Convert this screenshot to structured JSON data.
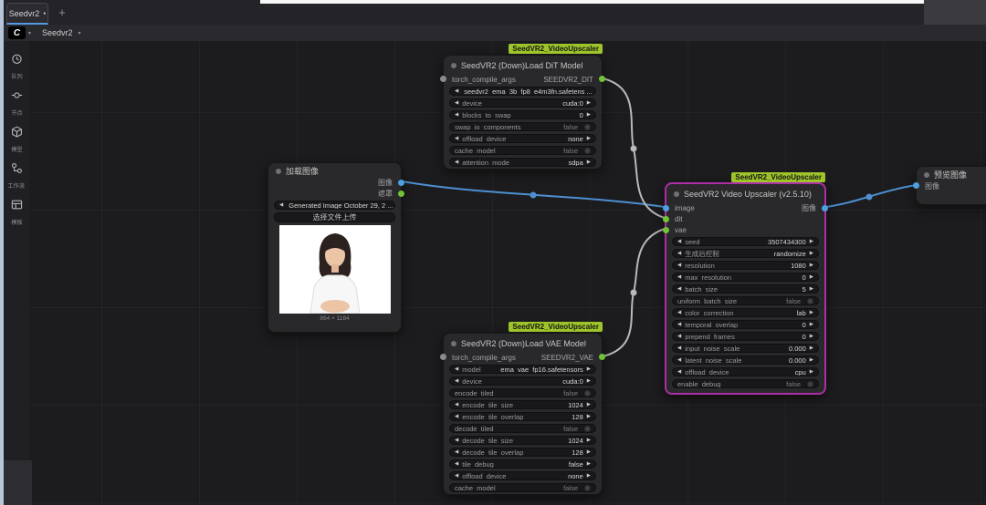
{
  "colors": {
    "link_image": "#4d8fd1",
    "link_model": "#b9b9b9",
    "slot_image_blue": "#4d9fe0",
    "slot_model_green": "#72c235",
    "group_tag_bg": "#9dc42a",
    "selected_node_border": "#ad2ea6",
    "tab_indicator": "#549ae0"
  },
  "icons": {
    "arrow_left": "◀",
    "arrow_right": "▶",
    "dirty_dot": "●",
    "caret_down": "▾",
    "plus": "+",
    "logo_letter": "C"
  },
  "tab_bar": {
    "active_tab": "Seedvr2"
  },
  "menu_bar": {
    "workflow_name": "Seedvr2"
  },
  "sidebar": {
    "items": [
      {
        "icon": "queue-icon",
        "label": "队列"
      },
      {
        "icon": "nodes-icon",
        "label": "节点"
      },
      {
        "icon": "models-icon",
        "label": "模型"
      },
      {
        "icon": "workflows-icon",
        "label": "工作流"
      },
      {
        "icon": "templates-icon",
        "label": "模板"
      }
    ]
  },
  "nodes": {
    "load_image": {
      "title": "加载图像",
      "outputs": [
        {
          "label": "图像"
        },
        {
          "label": "遮罩"
        }
      ],
      "file_combo": "Generated Image October 29, 2 ...",
      "upload_button": "选择文件上传",
      "image_caption": "864 × 1184"
    },
    "dit_loader": {
      "group_tag": "SeedVR2_VideoUpscaler",
      "title": "SeedVR2 (Down)Load DiT Model",
      "input": "torch_compile_args",
      "output": "SEEDVR2_DIT",
      "widgets": [
        {
          "name": "",
          "value": "seedvr2_ema_3b_fp8_e4m3fn.safetens ..."
        },
        {
          "name": "device",
          "value": "cuda:0"
        },
        {
          "name": "blocks_to_swap",
          "value": "0"
        },
        {
          "name": "swap_io_components",
          "value": "false"
        },
        {
          "name": "offload_device",
          "value": "none"
        },
        {
          "name": "cache_model",
          "value": "false"
        },
        {
          "name": "attention_mode",
          "value": "sdpa"
        }
      ]
    },
    "vae_loader": {
      "group_tag": "SeedVR2_VideoUpscaler",
      "title": "SeedVR2 (Down)Load VAE Model",
      "input": "torch_compile_args",
      "output": "SEEDVR2_VAE",
      "widgets": [
        {
          "name": "model",
          "value": "ema_vae_fp16.safetensors"
        },
        {
          "name": "device",
          "value": "cuda:0"
        },
        {
          "name": "encode_tiled",
          "value": "false"
        },
        {
          "name": "encode_tile_size",
          "value": "1024"
        },
        {
          "name": "encode_tile_overlap",
          "value": "128"
        },
        {
          "name": "decode_tiled",
          "value": "false"
        },
        {
          "name": "decode_tile_size",
          "value": "1024"
        },
        {
          "name": "decode_tile_overlap",
          "value": "128"
        },
        {
          "name": "tile_debug",
          "value": "false"
        },
        {
          "name": "offload_device",
          "value": "none"
        },
        {
          "name": "cache_model",
          "value": "false"
        }
      ]
    },
    "upscaler": {
      "group_tag": "SeedVR2_VideoUpscaler",
      "title": "SeedVR2 Video Upscaler (v2.5.10)",
      "inputs": [
        {
          "label": "image"
        },
        {
          "label": "dit"
        },
        {
          "label": "vae"
        }
      ],
      "output": "图像",
      "widgets": [
        {
          "name": "seed",
          "value": "3507434300"
        },
        {
          "name": "生成后控制",
          "value": "randomize"
        },
        {
          "name": "resolution",
          "value": "1080"
        },
        {
          "name": "max_resolution",
          "value": "0"
        },
        {
          "name": "batch_size",
          "value": "5"
        },
        {
          "name": "uniform_batch_size",
          "value": "false"
        },
        {
          "name": "color_correction",
          "value": "lab"
        },
        {
          "name": "temporal_overlap",
          "value": "0"
        },
        {
          "name": "prepend_frames",
          "value": "0"
        },
        {
          "name": "input_noise_scale",
          "value": "0.000"
        },
        {
          "name": "latent_noise_scale",
          "value": "0.000"
        },
        {
          "name": "offload_device",
          "value": "cpu"
        },
        {
          "name": "enable_debug",
          "value": "false"
        }
      ]
    },
    "preview": {
      "title": "预览图像",
      "input": "图像"
    }
  }
}
